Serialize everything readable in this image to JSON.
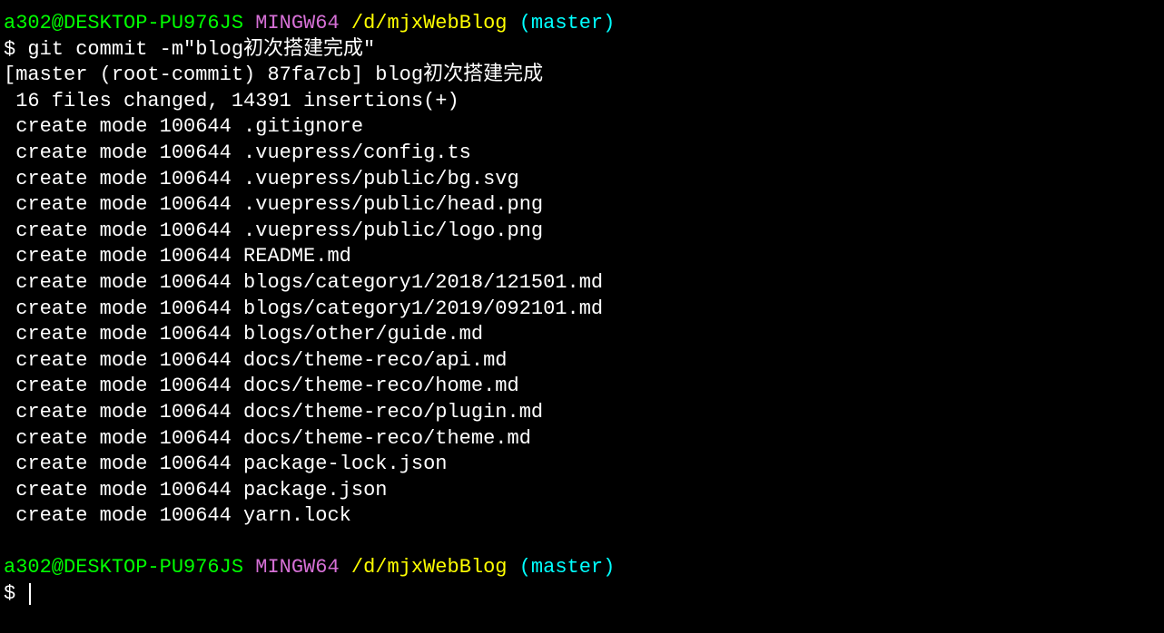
{
  "prompt1": {
    "user_host": "a302@DESKTOP-PU976JS",
    "env": "MINGW64",
    "path": "/d/mjxWebBlog",
    "branch": "(master)"
  },
  "command": "$ git commit -m\"blog初次搭建完成\"",
  "output": {
    "commit_line": "[master (root-commit) 87fa7cb] blog初次搭建完成",
    "changes_line": " 16 files changed, 14391 insertions(+)",
    "files": [
      " create mode 100644 .gitignore",
      " create mode 100644 .vuepress/config.ts",
      " create mode 100644 .vuepress/public/bg.svg",
      " create mode 100644 .vuepress/public/head.png",
      " create mode 100644 .vuepress/public/logo.png",
      " create mode 100644 README.md",
      " create mode 100644 blogs/category1/2018/121501.md",
      " create mode 100644 blogs/category1/2019/092101.md",
      " create mode 100644 blogs/other/guide.md",
      " create mode 100644 docs/theme-reco/api.md",
      " create mode 100644 docs/theme-reco/home.md",
      " create mode 100644 docs/theme-reco/plugin.md",
      " create mode 100644 docs/theme-reco/theme.md",
      " create mode 100644 package-lock.json",
      " create mode 100644 package.json",
      " create mode 100644 yarn.lock"
    ]
  },
  "prompt2": {
    "user_host": "a302@DESKTOP-PU976JS",
    "env": "MINGW64",
    "path": "/d/mjxWebBlog",
    "branch": "(master)"
  },
  "final_prompt": "$ "
}
